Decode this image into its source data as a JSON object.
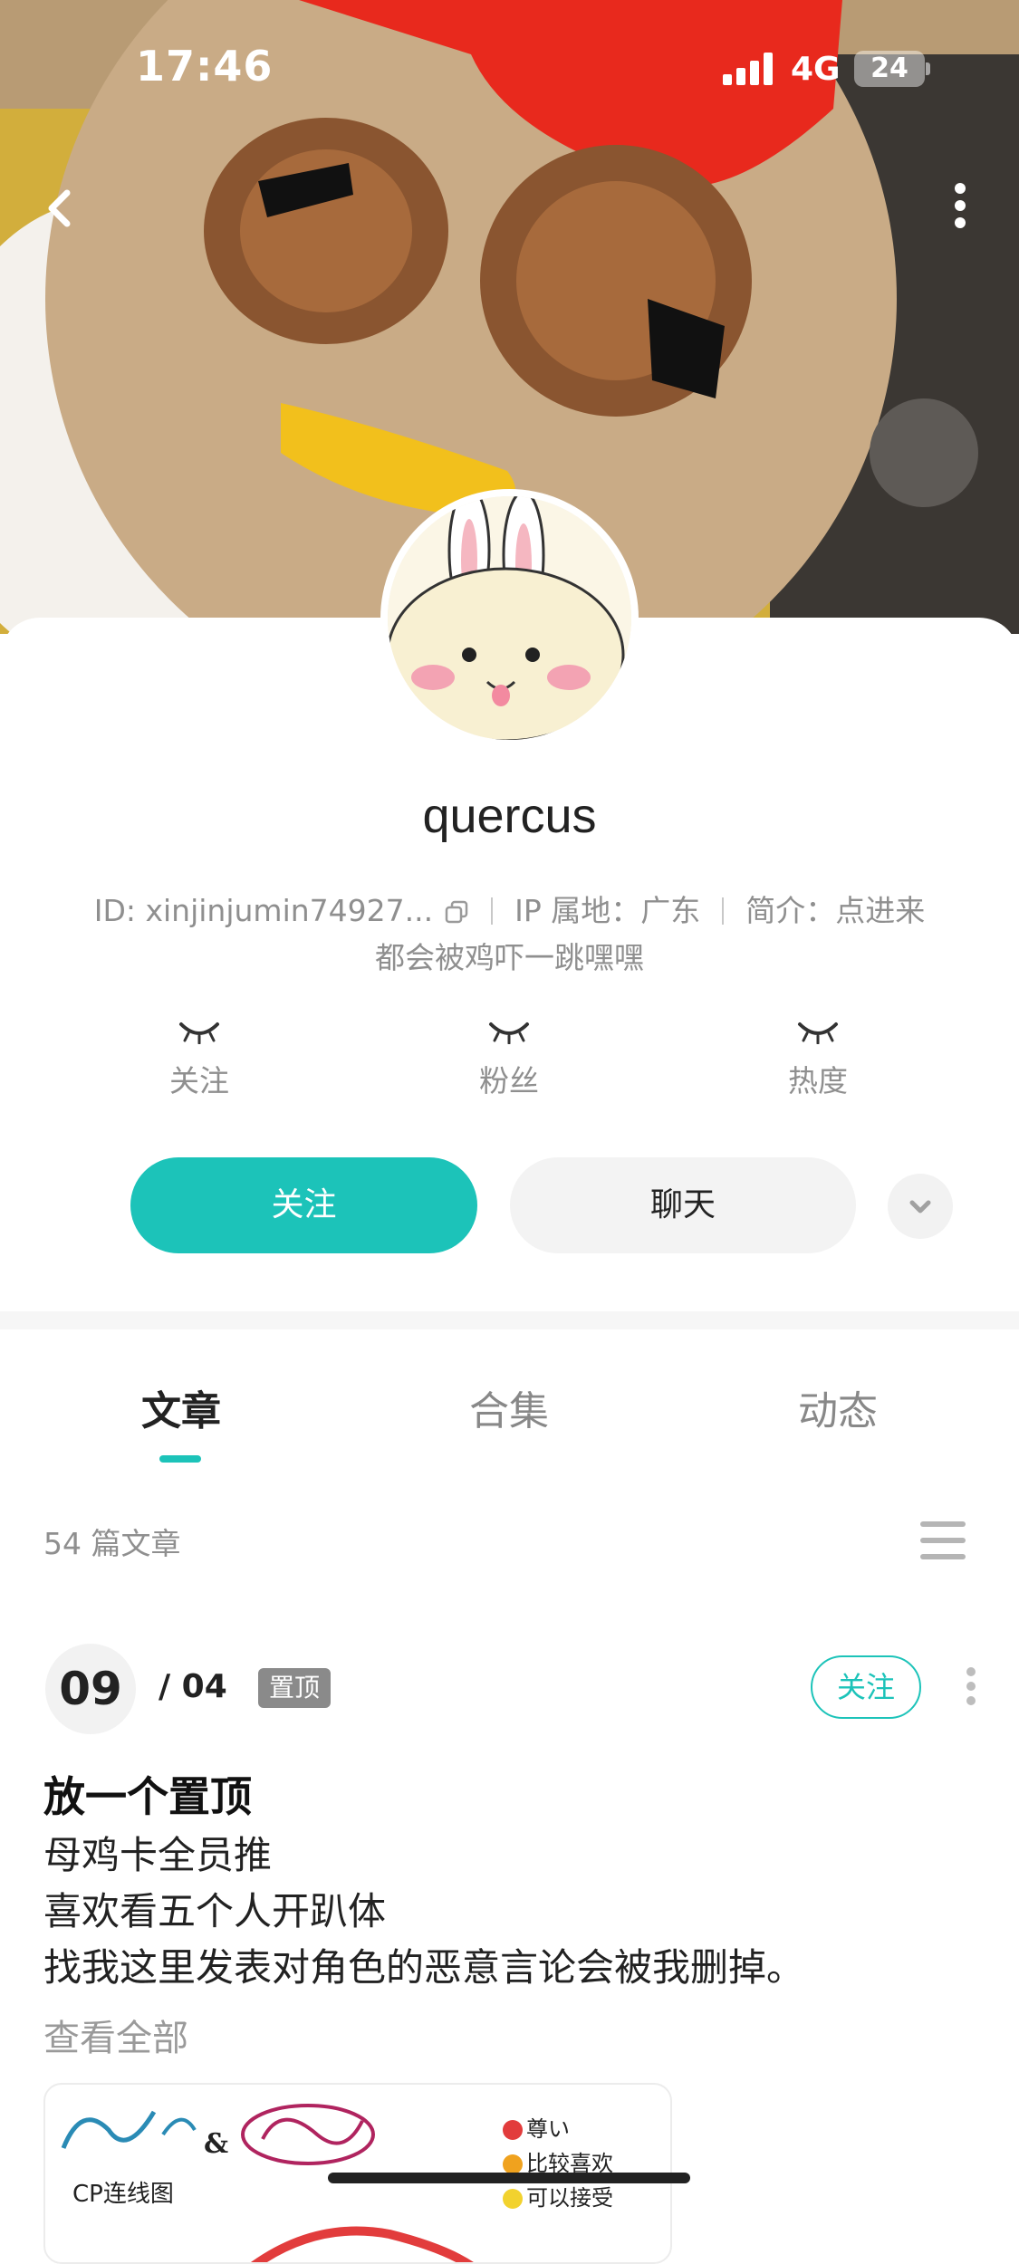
{
  "status_bar": {
    "time": "17:46",
    "network": "4G",
    "battery": "24"
  },
  "profile": {
    "username": "quercus",
    "id_text": "ID: xinjinjumin74927...",
    "ip_location": "IP 属地：广东",
    "bio_label": "简介：点进来",
    "bio_continued": "都会被鸡吓一跳嘿嘿"
  },
  "stats": [
    {
      "label": "关注",
      "icon": "closed-eye-icon"
    },
    {
      "label": "粉丝",
      "icon": "closed-eye-icon"
    },
    {
      "label": "热度",
      "icon": "closed-eye-icon"
    }
  ],
  "actions": {
    "follow_label": "关注",
    "chat_label": "聊天"
  },
  "tabs": [
    {
      "label": "文章",
      "active": true
    },
    {
      "label": "合集",
      "active": false
    },
    {
      "label": "动态",
      "active": false
    }
  ],
  "article_count": "54 篇文章",
  "post": {
    "day": "09",
    "month": "/ 04",
    "pinned_badge": "置顶",
    "follow_label": "关注",
    "title": "放一个置顶",
    "lines": [
      "母鸡卡全员推",
      "喜欢看五个人开趴体",
      "找我这里发表对角色的恶意言论会被我删掉。"
    ],
    "see_all": "查看全部",
    "image": {
      "caption": "CP连线图",
      "legend": [
        {
          "label": "尊い",
          "color": "#e23c3c"
        },
        {
          "label": "比较喜欢",
          "color": "#f0a21e"
        },
        {
          "label": "可以接受",
          "color": "#f2d22e"
        }
      ]
    }
  },
  "colors": {
    "accent": "#1cc3b9",
    "muted_text": "#8f8f8f",
    "pin_badge": "#8a8a8a"
  }
}
